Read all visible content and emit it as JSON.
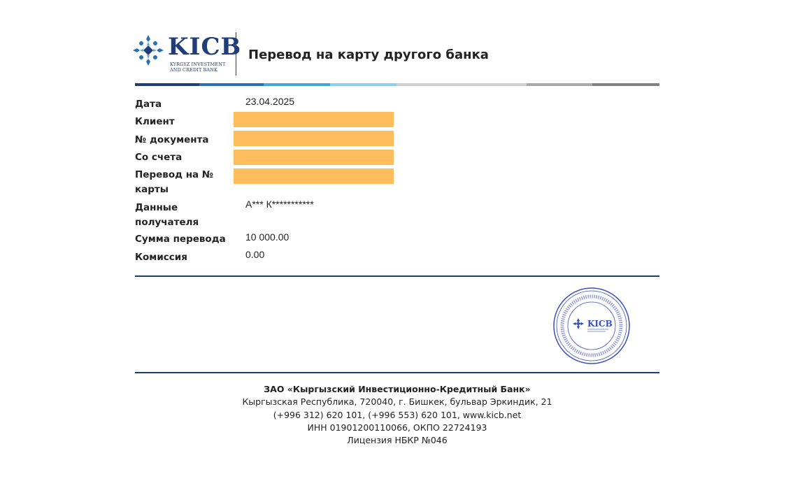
{
  "logo": {
    "word": "KICB",
    "sub_line1": "KYRGYZ INVESTMENT",
    "sub_line2": "AND CREDIT BANK",
    "icon": "snowflake-logo-icon"
  },
  "document": {
    "title": "Перевод на карту другого банка"
  },
  "colors": {
    "brand_blue": "#1f3d78",
    "redaction": "#ffbd5e"
  },
  "fields": [
    {
      "label": "Дата",
      "value": "23.04.2025"
    },
    {
      "label": "Клиент",
      "value": ""
    },
    {
      "label": "№ документа",
      "value": ""
    },
    {
      "label": "Со счета",
      "value": ""
    },
    {
      "label": "Перевод на № карты",
      "value": ""
    },
    {
      "label": "Данные получателя",
      "value": "А*** К***********"
    },
    {
      "label": "Сумма перевода",
      "value": "10 000.00"
    },
    {
      "label": "Комиссия",
      "value": "0.00"
    }
  ],
  "stamp": {
    "word": "KICB",
    "icon": "bank-stamp-icon"
  },
  "footer": {
    "company": "ЗАО «Кыргызский Инвестиционно-Кредитный Банк»",
    "address": "Кыргызская Республика, 720040, г. Бишкек, бульвар Эркиндик, 21",
    "contacts": "(+996 312) 620 101, (+996 553) 620 101, www.kicb.net",
    "ids": "ИНН 01901200110066, ОКПО 22724193",
    "license": "Лицензия НБКР №046"
  }
}
